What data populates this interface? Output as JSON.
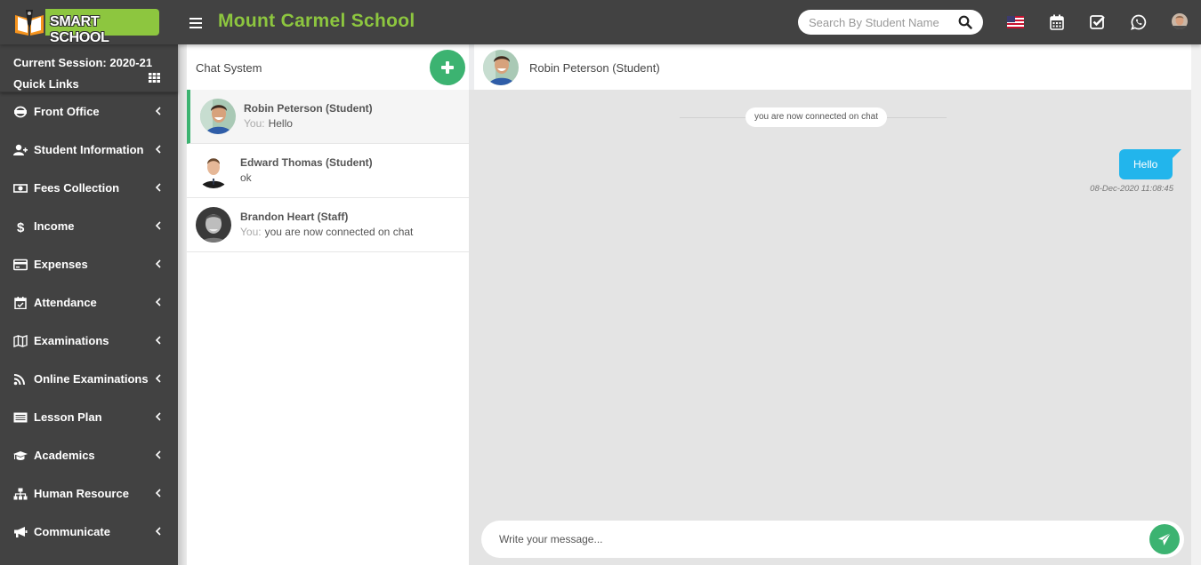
{
  "app": {
    "logo_text": "SMART SCHOOL",
    "school_name": "Mount Carmel School",
    "brand_color": "#8dc63f",
    "accent_green": "#3cb371",
    "bubble_blue": "#22b5ec"
  },
  "header": {
    "search": {
      "placeholder": "Search By Student Name",
      "value": ""
    },
    "icons": [
      "menu-icon",
      "search-icon",
      "us-flag-icon",
      "calendar-icon",
      "checkbox-icon",
      "whatsapp-icon",
      "user-avatar"
    ]
  },
  "sidebar": {
    "session_label": "Current Session: 2020-21",
    "quick_links_label": "Quick Links",
    "items": [
      {
        "label": "Front Office",
        "icon": "front-office-icon"
      },
      {
        "label": "Student Information",
        "icon": "user-plus-icon"
      },
      {
        "label": "Fees Collection",
        "icon": "money-icon"
      },
      {
        "label": "Income",
        "icon": "dollar-icon"
      },
      {
        "label": "Expenses",
        "icon": "credit-card-icon"
      },
      {
        "label": "Attendance",
        "icon": "calendar-check-icon"
      },
      {
        "label": "Examinations",
        "icon": "map-icon"
      },
      {
        "label": "Online Examinations",
        "icon": "rss-icon"
      },
      {
        "label": "Lesson Plan",
        "icon": "list-alt-icon"
      },
      {
        "label": "Academics",
        "icon": "graduation-cap-icon"
      },
      {
        "label": "Human Resource",
        "icon": "sitemap-icon"
      },
      {
        "label": "Communicate",
        "icon": "bullhorn-icon"
      }
    ]
  },
  "chat_list": {
    "title": "Chat System",
    "conversations": [
      {
        "name": "Robin Peterson (Student)",
        "you_prefix": "You:",
        "last_message": "Hello",
        "active": true
      },
      {
        "name": "Edward Thomas (Student)",
        "you_prefix": "",
        "last_message": "ok",
        "active": false
      },
      {
        "name": "Brandon Heart (Staff)",
        "you_prefix": "You:",
        "last_message": "you are now connected on chat",
        "active": false
      }
    ]
  },
  "chat_window": {
    "contact_name": "Robin Peterson (Student)",
    "system_message": "you are now connected on chat",
    "messages": [
      {
        "text": "Hello",
        "time": "08-Dec-2020 11:08:45",
        "direction": "outgoing"
      }
    ],
    "composer": {
      "placeholder": "Write your message...",
      "value": ""
    }
  }
}
